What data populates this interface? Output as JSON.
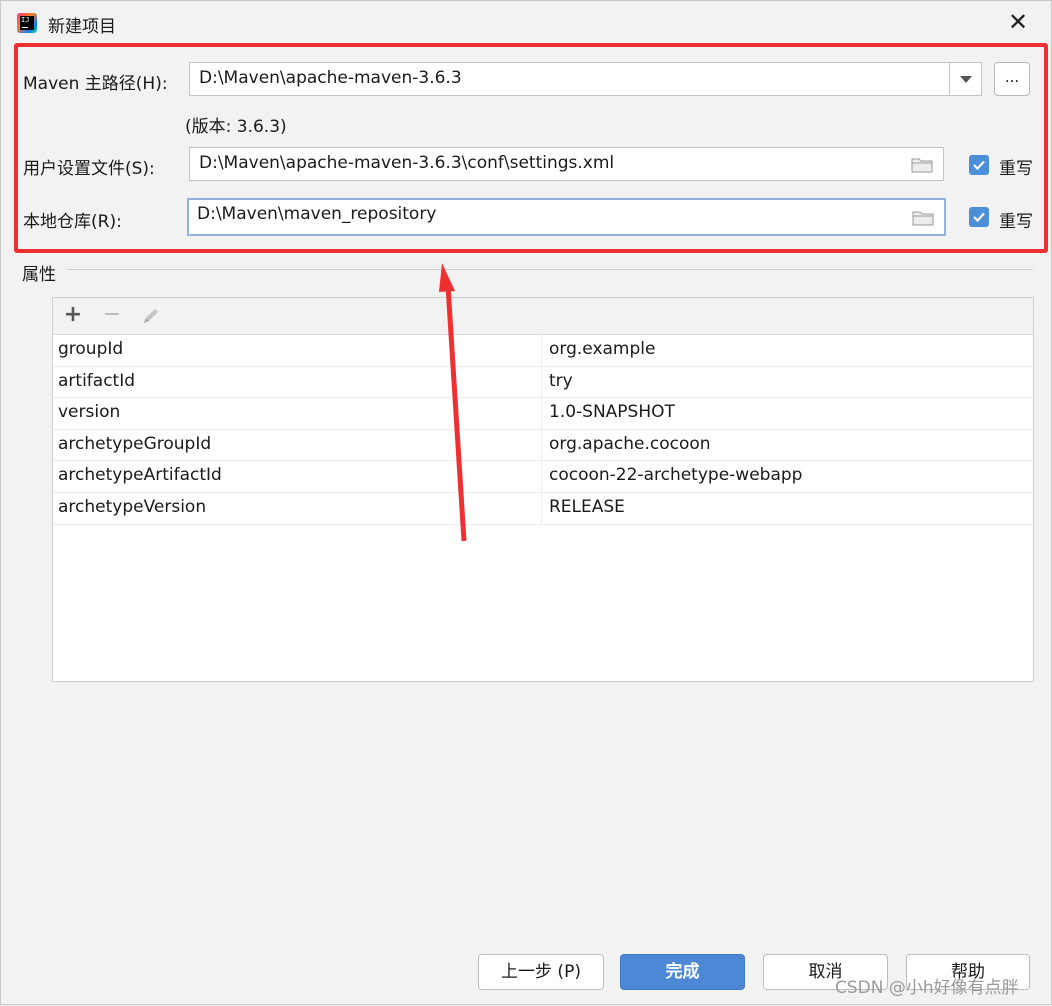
{
  "window": {
    "title": "新建项目",
    "close_glyph": "✕"
  },
  "maven_home": {
    "label": "Maven 主路径(H):",
    "value": "D:\\Maven\\apache-maven-3.6.3",
    "browse_label": "...",
    "version": "(版本: 3.6.3)"
  },
  "user_settings": {
    "label": "用户设置文件(S):",
    "value": "D:\\Maven\\apache-maven-3.6.3\\conf\\settings.xml",
    "override_label": "重写",
    "override_checked": true
  },
  "local_repo": {
    "label": "本地仓库(R):",
    "value": "D:\\Maven\\maven_repository",
    "override_label": "重写",
    "override_checked": true
  },
  "properties": {
    "title": "属性",
    "toolbar": {
      "add": "+",
      "remove": "−"
    },
    "rows": [
      {
        "key": "groupId",
        "value": "org.example"
      },
      {
        "key": "artifactId",
        "value": "try"
      },
      {
        "key": "version",
        "value": "1.0-SNAPSHOT"
      },
      {
        "key": "archetypeGroupId",
        "value": "org.apache.cocoon"
      },
      {
        "key": "archetypeArtifactId",
        "value": "cocoon-22-archetype-webapp"
      },
      {
        "key": "archetypeVersion",
        "value": "RELEASE"
      }
    ]
  },
  "buttons": {
    "previous": "上一步 (P)",
    "finish": "完成",
    "cancel": "取消",
    "help": "帮助"
  },
  "watermark": "CSDN @小h好像有点胖",
  "colors": {
    "highlight": "#f03030",
    "primary": "#4d88d6",
    "checkbox": "#4a8fd8"
  },
  "icons": [
    "app-icon",
    "close-icon",
    "dropdown-arrow-icon",
    "folder-icon",
    "checkmark-icon",
    "add-icon",
    "remove-icon",
    "edit-icon"
  ]
}
